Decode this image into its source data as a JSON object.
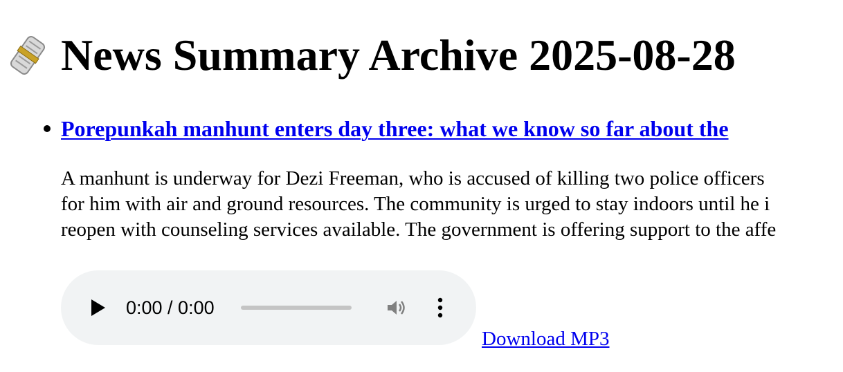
{
  "page": {
    "title": "News Summary Archive 2025-08-28",
    "icon": "newspaper-icon"
  },
  "articles": [
    {
      "title": "Porepunkah manhunt enters day three: what we know so far about the",
      "summary_lines": [
        "A manhunt is underway for Dezi Freeman, who is accused of killing two police officers",
        "for him with air and ground resources. The community is urged to stay indoors until he i",
        "reopen with counseling services available. The government is offering support to the affe"
      ],
      "audio": {
        "time_display": "0:00 / 0:00",
        "progress": 0,
        "play_icon": "play-icon",
        "volume_icon": "volume-icon",
        "more_icon": "more-options-icon"
      },
      "download_label": "Download MP3"
    }
  ]
}
